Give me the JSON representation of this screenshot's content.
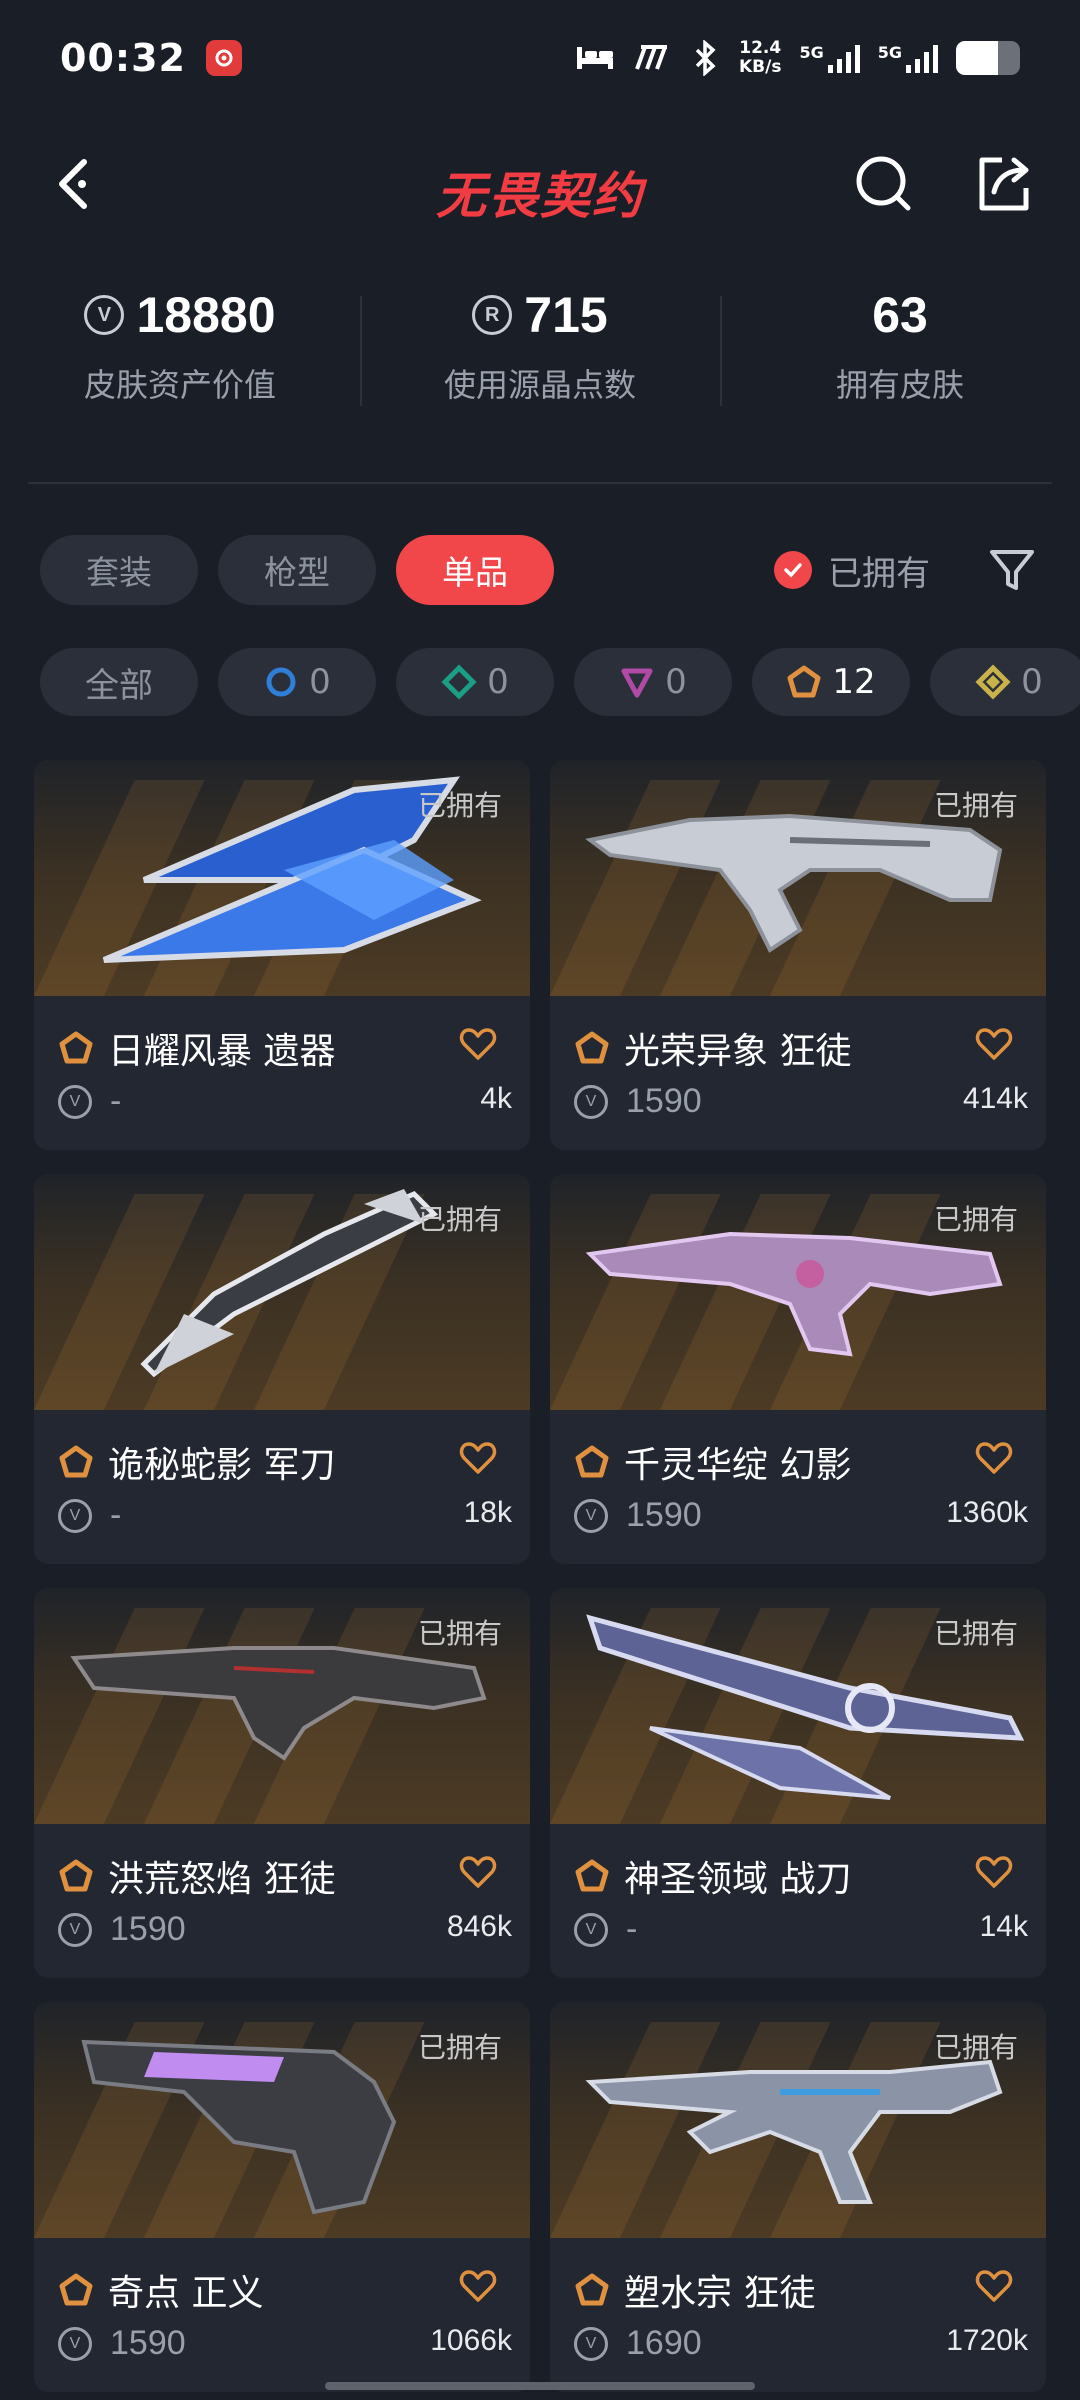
{
  "status_bar": {
    "time": "00:32",
    "speed_value": "12.4",
    "speed_unit": "KB/s",
    "sim1": "5G",
    "sim2": "5G",
    "battery_level": 0.65
  },
  "header": {
    "brand": "无畏契约"
  },
  "stats": [
    {
      "value": "18880",
      "label": "皮肤资产价值",
      "icon": "vp-icon"
    },
    {
      "value": "715",
      "label": "使用源晶点数",
      "icon": "radianite-icon"
    },
    {
      "value": "63",
      "label": "拥有皮肤",
      "icon": ""
    }
  ],
  "filters": {
    "tabs": [
      "套装",
      "枪型",
      "单品"
    ],
    "active_tab": "单品",
    "owned_label": "已拥有"
  },
  "rarity_filters": [
    {
      "label": "全部",
      "count": ""
    },
    {
      "label": "",
      "count": "0",
      "icon": "select-tier-icon",
      "color": "#2f7fd6"
    },
    {
      "label": "",
      "count": "0",
      "icon": "deluxe-tier-icon",
      "color": "#1a9f86"
    },
    {
      "label": "",
      "count": "0",
      "icon": "premium-tier-icon",
      "color": "#b04aa6"
    },
    {
      "label": "",
      "count": "12",
      "icon": "exclusive-tier-icon",
      "color": "#e0913f"
    },
    {
      "label": "",
      "count": "0",
      "icon": "ultra-tier-icon",
      "color": "#c9b24a"
    }
  ],
  "items": [
    {
      "name": "日耀风暴 遗器",
      "price": "-",
      "likes": "4k",
      "owned": "已拥有"
    },
    {
      "name": "光荣异象 狂徒",
      "price": "1590",
      "likes": "414k",
      "owned": "已拥有"
    },
    {
      "name": "诡秘蛇影 军刀",
      "price": "-",
      "likes": "18k",
      "owned": "已拥有"
    },
    {
      "name": "千灵华绽 幻影",
      "price": "1590",
      "likes": "1360k",
      "owned": "已拥有"
    },
    {
      "name": "洪荒怒焰 狂徒",
      "price": "1590",
      "likes": "846k",
      "owned": "已拥有"
    },
    {
      "name": "神圣领域 战刀",
      "price": "-",
      "likes": "14k",
      "owned": "已拥有"
    },
    {
      "name": "奇点 正义",
      "price": "1590",
      "likes": "1066k",
      "owned": "已拥有"
    },
    {
      "name": "塑水宗 狂徒",
      "price": "1690",
      "likes": "1720k",
      "owned": "已拥有"
    }
  ],
  "colors": {
    "accent": "#f2474a",
    "exclusive_tier": "#e0913f",
    "background": "#1a1e26"
  }
}
